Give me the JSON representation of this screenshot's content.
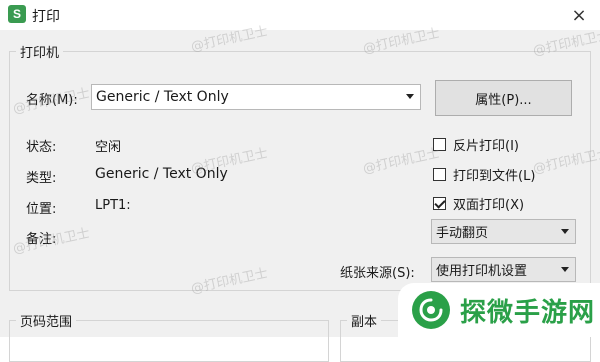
{
  "window": {
    "app_icon_letter": "S",
    "title": "打印",
    "close_glyph": "×"
  },
  "printer_group": {
    "label": "打印机",
    "name_label": "名称(M):",
    "name_value": "Generic / Text Only",
    "properties_button": "属性(P)...",
    "status_label": "状态:",
    "status_value": "空闲",
    "type_label": "类型:",
    "type_value": "Generic / Text Only",
    "location_label": "位置:",
    "location_value": "LPT1:",
    "comment_label": "备注:",
    "options": {
      "reverse_print": {
        "label": "反片打印(I)",
        "checked": false
      },
      "print_to_file": {
        "label": "打印到文件(L)",
        "checked": false
      },
      "duplex": {
        "label": "双面打印(X)",
        "checked": true
      }
    },
    "duplex_mode": "手动翻页",
    "paper_source_label": "纸张来源(S):",
    "paper_source_value": "使用打印机设置"
  },
  "page_range_group": {
    "label": "页码范围"
  },
  "copies_group": {
    "label": "副本"
  },
  "watermark": "@打印机卫士",
  "badge": {
    "text": "探微手游网"
  },
  "colors": {
    "accent_green": "#2aa048",
    "app_icon_green": "#3a9b51"
  }
}
